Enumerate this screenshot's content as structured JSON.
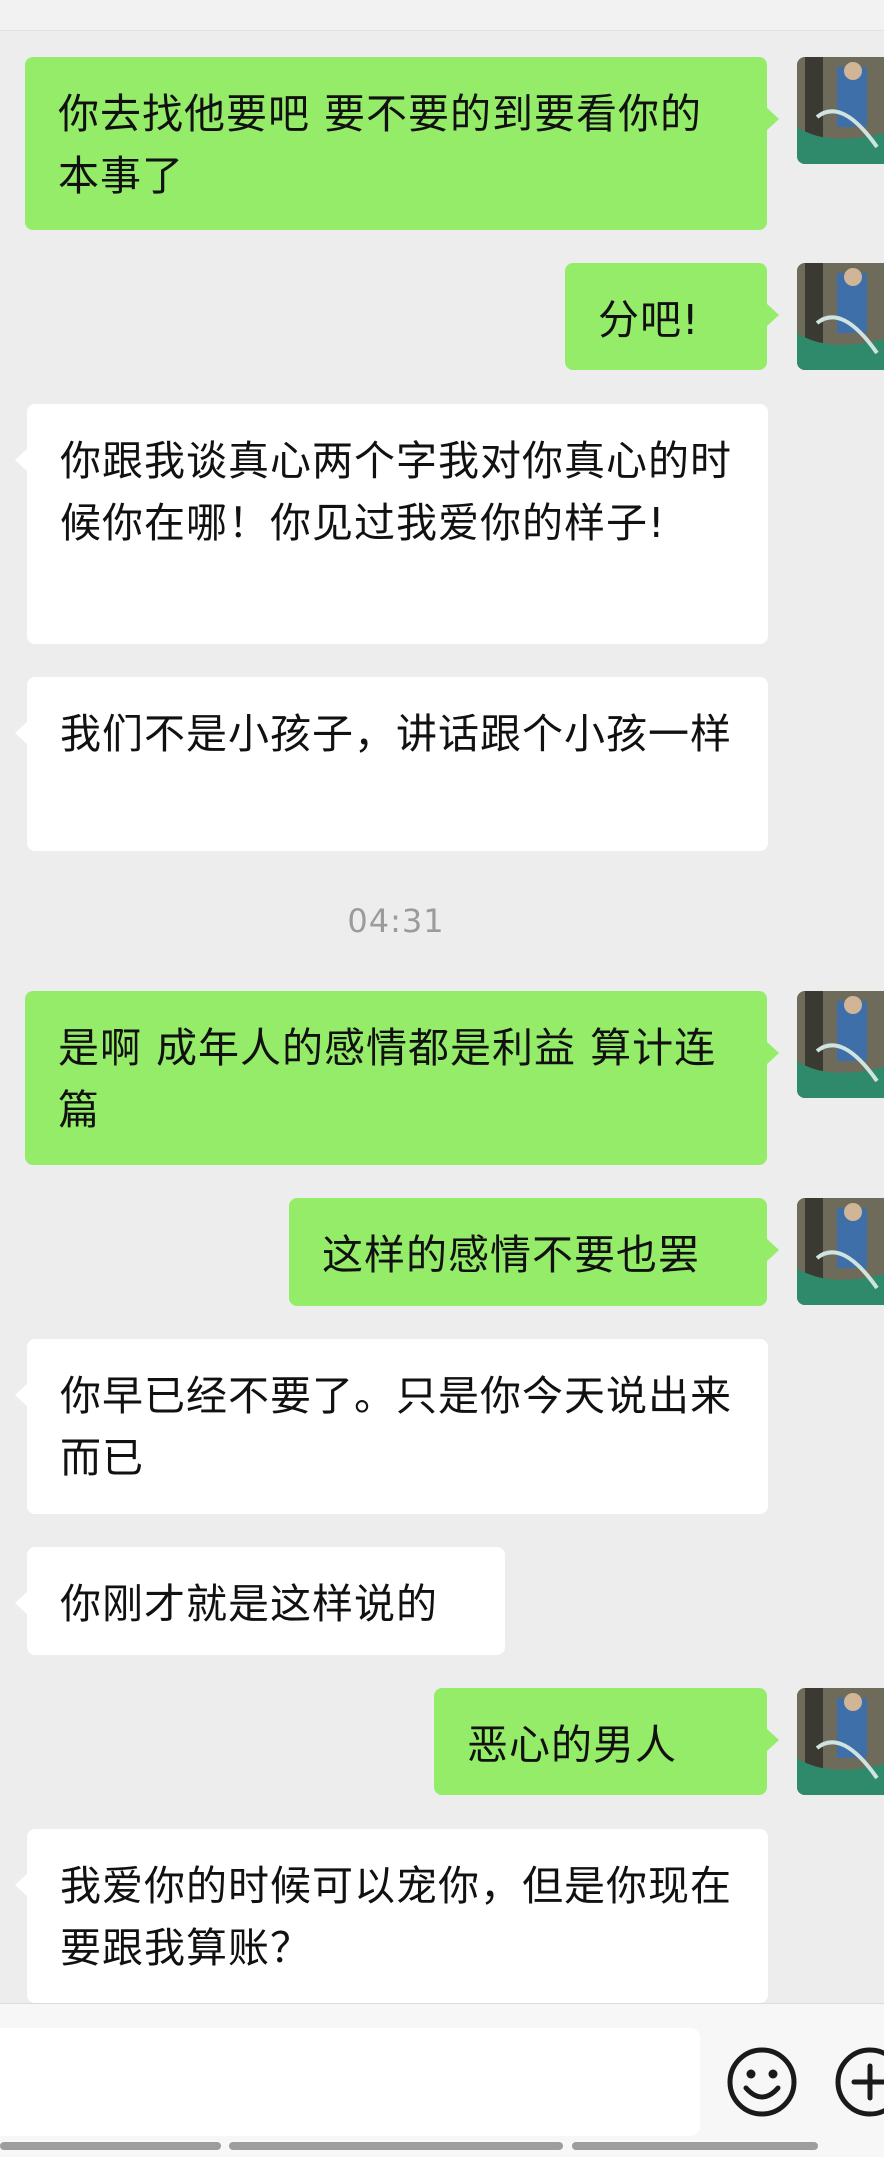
{
  "messages": [
    {
      "side": "mine",
      "text": "你去找他要吧   要不要的到要看你的本事了"
    },
    {
      "side": "mine",
      "text": "分吧!"
    },
    {
      "side": "theirs",
      "text": "你跟我谈真心两个字我对你真心的时候你在哪！你见过我爱你的样子!"
    },
    {
      "side": "theirs",
      "text": "我们不是小孩子，讲话跟个小孩一样"
    },
    {
      "side": "mine",
      "text": "是啊  成年人的感情都是利益 算计连篇"
    },
    {
      "side": "mine",
      "text": "这样的感情不要也罢"
    },
    {
      "side": "theirs",
      "text": "你早已经不要了。只是你今天说出来而已"
    },
    {
      "side": "theirs",
      "text": "你刚才就是这样说的"
    },
    {
      "side": "mine",
      "text": "恶心的男人"
    },
    {
      "side": "theirs",
      "text": "我爱你的时候可以宠你，但是你现在要跟我算账？"
    }
  ],
  "timestamp": "04:31",
  "input_bar": {
    "value": "",
    "emoji_icon": "smiley-face-icon",
    "more_icon": "plus-circle-icon"
  },
  "colors": {
    "background": "#ededed",
    "mine_bubble": "#95ec69",
    "theirs_bubble": "#ffffff",
    "timestamp_text": "#9b9b9b"
  }
}
